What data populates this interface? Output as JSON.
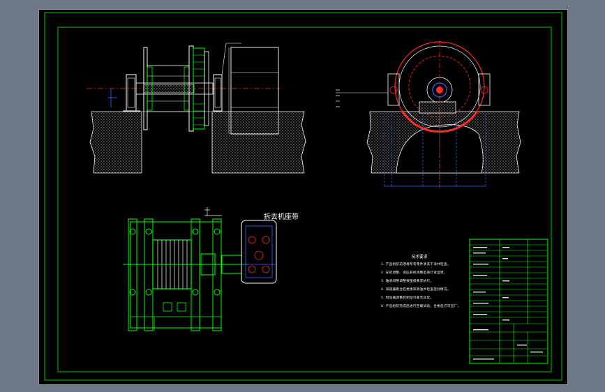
{
  "app": {
    "background_color": "#6d7787",
    "viewport_background": "#000000",
    "border_color": "#00c800",
    "accent_colors": {
      "green": "#00ff00",
      "red": "#ff2a2a",
      "blue": "#3366ff",
      "white": "#ffffff",
      "gray_hatch": "#9a9a9a"
    }
  },
  "drawing": {
    "section_label": "拆去机座带",
    "tech_notes": {
      "title": "技术要求",
      "lines": [
        "1. 产品组装前须将所有零件清洗干净并检查。",
        "2. 安装调整、液压系统调整后进行试运转。",
        "3. 轴承间隙调整按图纸要求执行。",
        "4. 减速器跑合后更换润滑油并检查密封情况。",
        "5. 制动器调整后制动可靠无异常。",
        "6. 产品组装完成后进行空载试验，合格后方可出厂。"
      ]
    },
    "title_block": {
      "label": "title-block"
    }
  }
}
